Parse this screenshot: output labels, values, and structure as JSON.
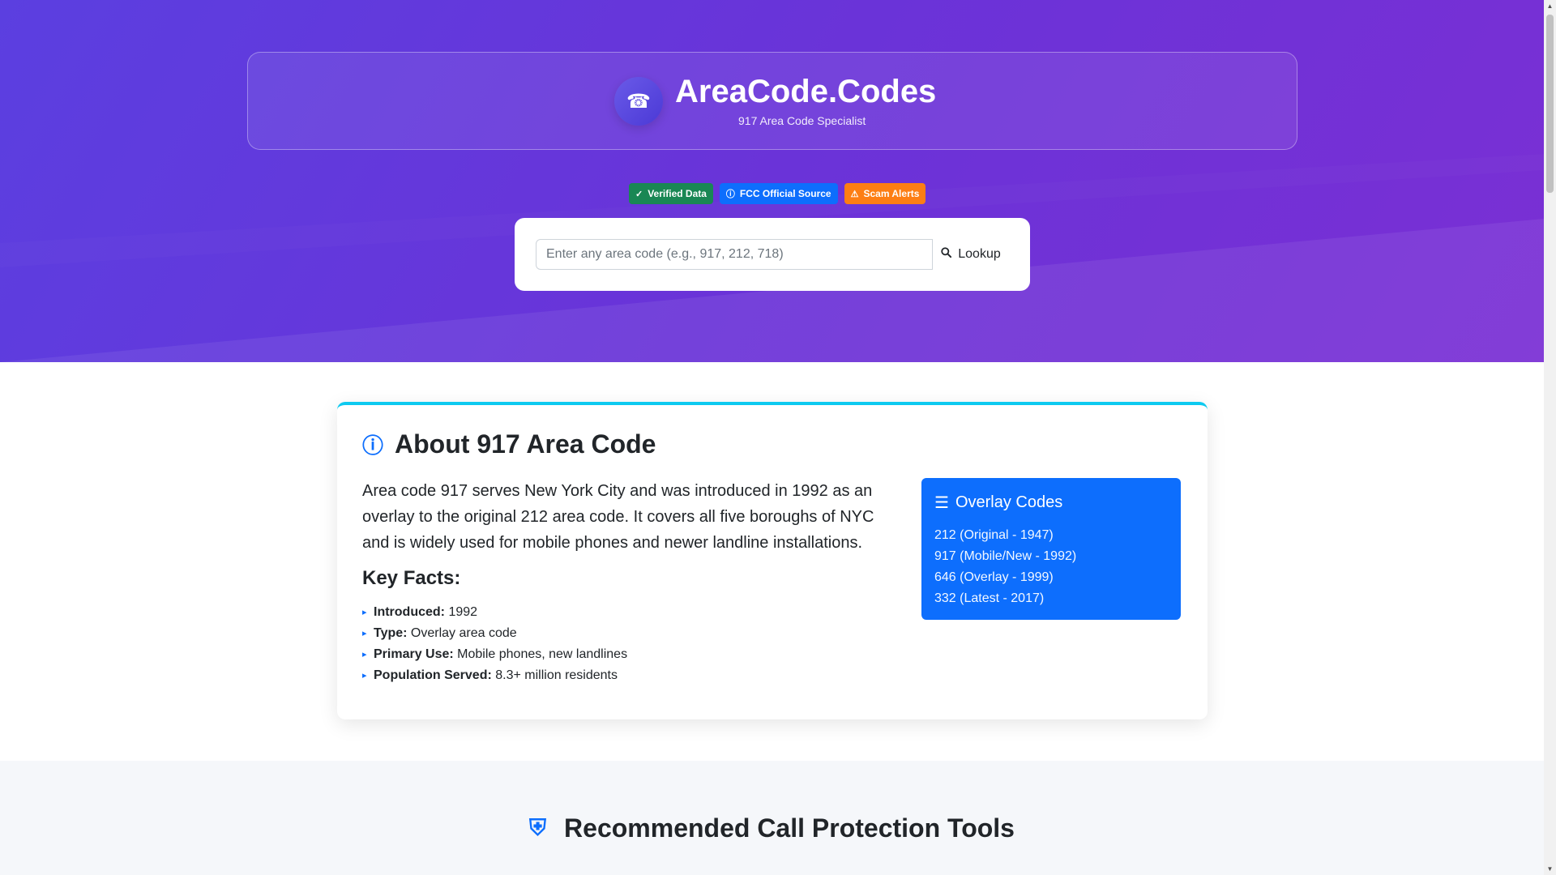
{
  "brand": {
    "icon": "phone-icon",
    "title": "AreaCode.Codes",
    "subtitle": "917 Area Code Specialist"
  },
  "badges": [
    {
      "label": "Verified Data",
      "icon": "check-shield-icon",
      "color": "#198754"
    },
    {
      "label": "FCC Official Source",
      "icon": "info-icon",
      "color": "#0d6efd"
    },
    {
      "label": "Scam Alerts",
      "icon": "warning-icon",
      "color": "#fd7e14"
    }
  ],
  "search": {
    "placeholder": "Enter any area code (e.g., 917, 212, 718)",
    "value": "",
    "button_label": "Lookup",
    "button_icon": "search-icon"
  },
  "about": {
    "title": "About 917 Area Code",
    "icon": "info-circle-icon",
    "description": "Area code 917 serves New York City and was introduced in 1992 as an overlay to the original 212 area code. It covers all five boroughs of NYC and is widely used for mobile phones and newer landline installations.",
    "facts_title": "Key Facts:",
    "facts": [
      {
        "label": "Introduced:",
        "value": " 1992"
      },
      {
        "label": "Type:",
        "value": " Overlay area code"
      },
      {
        "label": "Primary Use:",
        "value": " Mobile phones, new landlines"
      },
      {
        "label": "Population Served:",
        "value": " 8.3+ million residents"
      }
    ]
  },
  "overlay": {
    "title": "Overlay Codes",
    "icon": "layers-icon",
    "items": [
      "212 (Original - 1947)",
      "917 (Mobile/New - 1992)",
      "646 (Overlay - 1999)",
      "332 (Latest - 2017)"
    ]
  },
  "tools": {
    "title": "Recommended Call Protection Tools",
    "icon": "shield-icon"
  },
  "colors": {
    "hero_start": "#5b3fe0",
    "hero_end": "#7a2fd4",
    "accent_blue": "#0d6efd",
    "accent_cyan": "#0dcaf0"
  }
}
